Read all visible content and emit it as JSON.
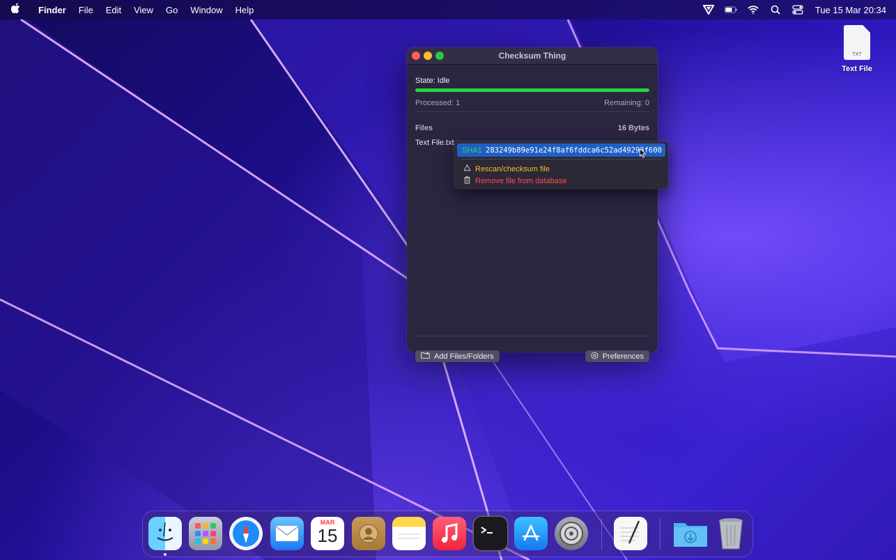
{
  "menubar": {
    "apple": "",
    "app_name": "Finder",
    "menus": [
      "File",
      "Edit",
      "View",
      "Go",
      "Window",
      "Help"
    ],
    "clock": "Tue 15 Mar  20:34"
  },
  "desktop": {
    "file_name": "Text File",
    "file_ext": "TXT"
  },
  "window": {
    "title": "Checksum Thing",
    "state": "State: Idle",
    "progress_fraction": 1.0,
    "processed": "Processed: 1",
    "remaining": "Remaining: 0",
    "files_header": "Files",
    "total_size": "16 Bytes",
    "file_row": "Text File.txt",
    "add_button": "Add Files/Folders",
    "prefs_button": "Preferences"
  },
  "popup": {
    "hash_label": "SHA1",
    "hash_value": "283249b89e91e24f8af6fddca6c52ad49293f600",
    "rescan": "Rescan/checksum file",
    "remove": "Remove file from database"
  },
  "dock": {
    "calendar_month": "MAR",
    "calendar_day": "15",
    "apps": [
      "finder",
      "launchpad",
      "safari",
      "mail",
      "calendar",
      "contacts",
      "notes",
      "music",
      "terminal",
      "app-store",
      "system-preferences",
      "textedit",
      "downloads",
      "trash"
    ]
  },
  "colors": {
    "progress": "#29d53a",
    "highlight": "#1f5fc4",
    "rescan": "#f2c21c",
    "remove": "#ff4a4a"
  }
}
